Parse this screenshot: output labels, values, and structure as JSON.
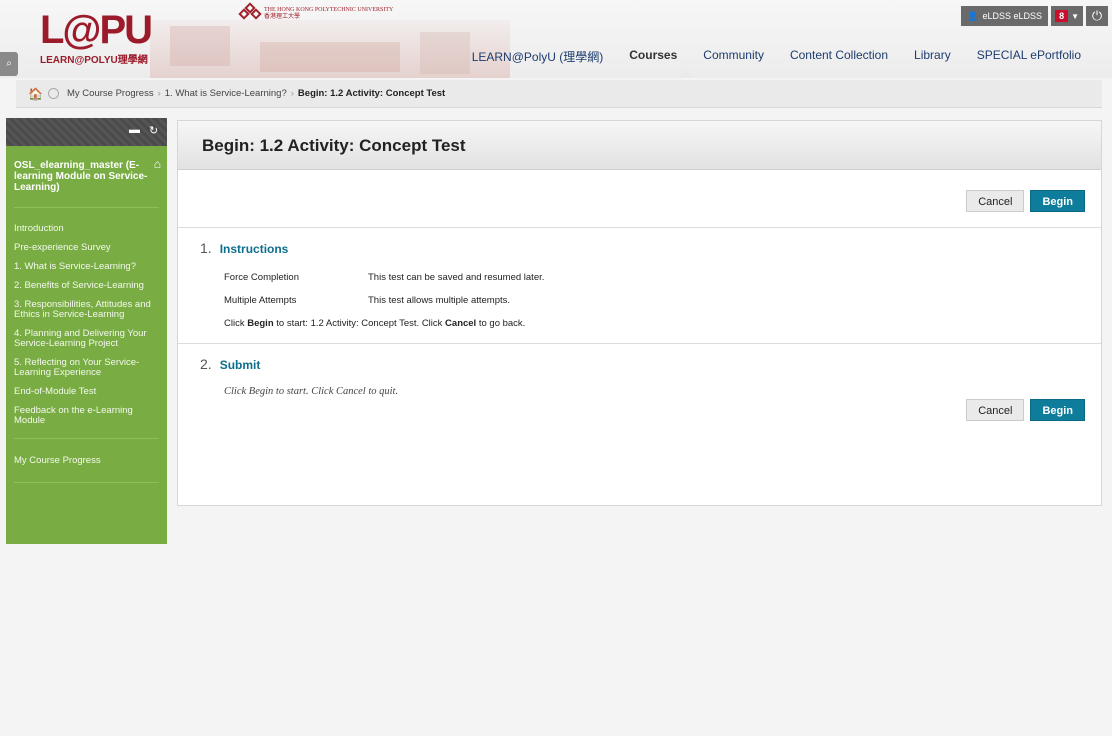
{
  "header": {
    "logo_text": "L@PU",
    "logo_subtitle": "LEARN@POLYU理學網",
    "university_name": "THE HONG KONG POLYTECHNIC UNIVERSITY",
    "university_chinese": "香港理工大學",
    "nav": [
      {
        "label": "LEARN@PolyU (理學網)",
        "active": false
      },
      {
        "label": "Courses",
        "active": true
      },
      {
        "label": "Community",
        "active": false
      },
      {
        "label": "Content Collection",
        "active": false
      },
      {
        "label": "Library",
        "active": false
      },
      {
        "label": "SPECIAL ePortfolio",
        "active": false
      }
    ],
    "user_name": "eLDSS eLDSS",
    "notification_count": "8"
  },
  "breadcrumb": {
    "items": [
      "My Course Progress",
      "1. What is Service-Learning?"
    ],
    "current": "Begin: 1.2 Activity: Concept Test"
  },
  "course_menu": {
    "course_title": "OSL_elearning_master (E-learning Module on Service-Learning)",
    "items": [
      "Introduction",
      "Pre-experience Survey",
      "1. What is Service-Learning?",
      "2. Benefits of Service-Learning",
      "3. Responsibilities, Attitudes and Ethics in Service-Learning",
      "4. Planning and Delivering Your Service-Learning Project",
      "5. Reflecting on Your Service-Learning Experience",
      "End-of-Module Test",
      "Feedback on the e-Learning Module"
    ],
    "bottom_item": "My Course Progress"
  },
  "content": {
    "page_title": "Begin: 1.2 Activity: Concept Test",
    "cancel_label": "Cancel",
    "begin_label": "Begin",
    "step1": {
      "number": "1.",
      "title": "Instructions",
      "rows": [
        {
          "label": "Force Completion",
          "value": "This test can be saved and resumed later."
        },
        {
          "label": "Multiple Attempts",
          "value": "This test allows multiple attempts."
        }
      ],
      "instruction_click": "Click",
      "instruction_begin": "Begin",
      "instruction_mid": "to start: 1.2 Activity: Concept Test. Click",
      "instruction_cancel": "Cancel",
      "instruction_end": "to go back."
    },
    "step2": {
      "number": "2.",
      "title": "Submit",
      "text": "Click Begin to start. Click Cancel to quit."
    }
  }
}
